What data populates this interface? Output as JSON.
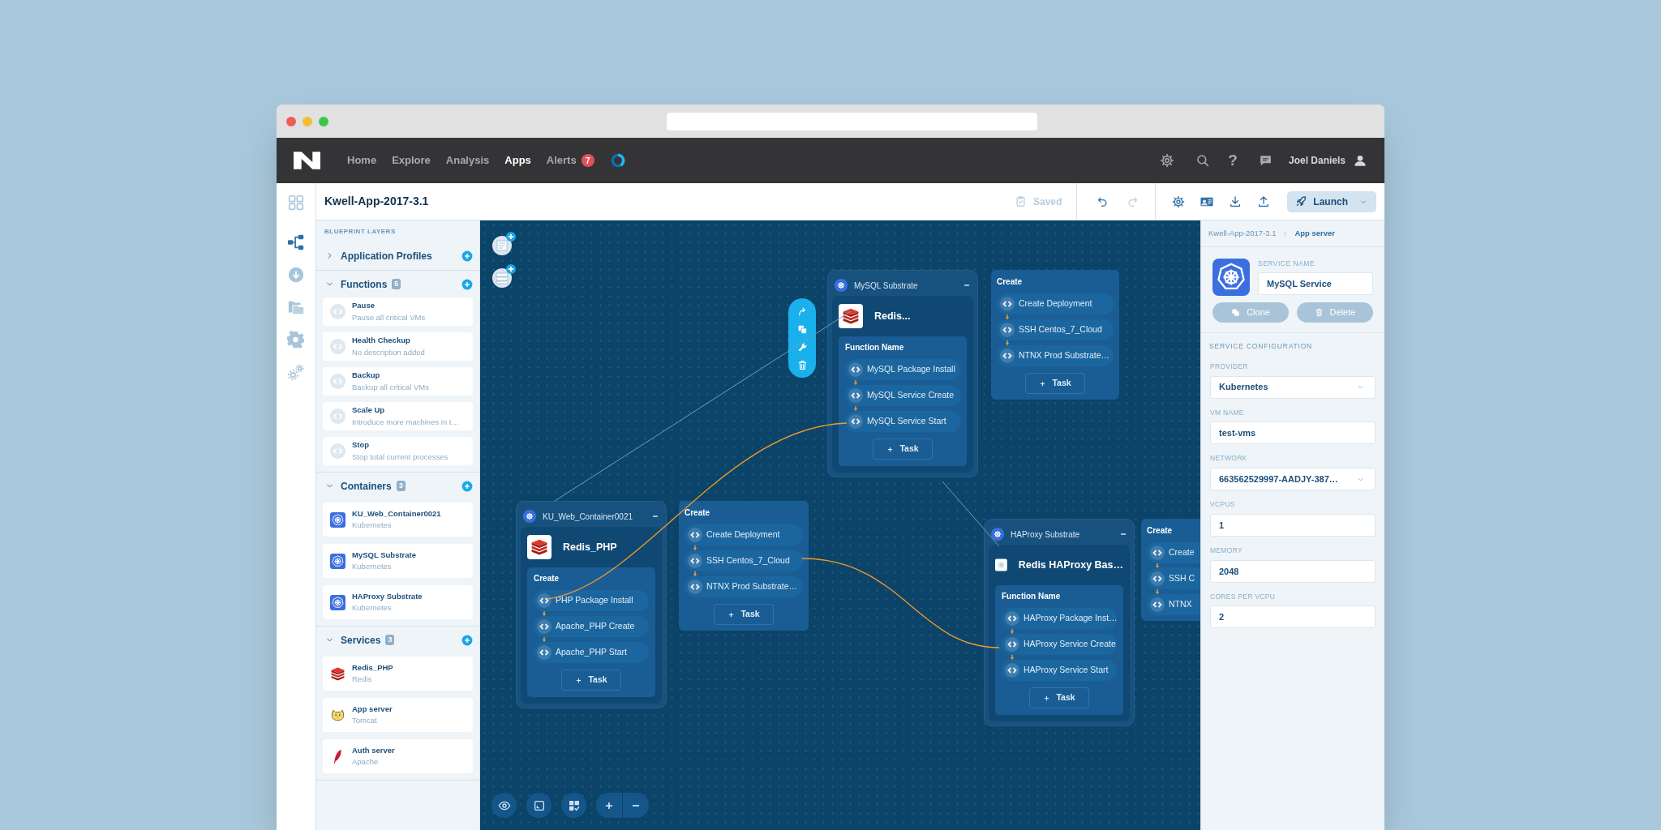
{
  "nav": {
    "links": [
      {
        "label": "Home",
        "selected": false
      },
      {
        "label": "Explore",
        "selected": false
      },
      {
        "label": "Analysis",
        "selected": false
      },
      {
        "label": "Apps",
        "selected": true
      },
      {
        "label": "Alerts",
        "selected": false,
        "badge": "7"
      }
    ],
    "help": "?",
    "user": "Joel Daniels"
  },
  "header": {
    "title": "Kwell-App-2017-3.1",
    "saved": "Saved",
    "launch": "Launch"
  },
  "rail": [
    {
      "kind": "grid",
      "selected": false
    },
    {
      "kind": "blueprint",
      "selected": true
    },
    {
      "kind": "download",
      "selected": false
    },
    {
      "kind": "folders",
      "selected": false
    },
    {
      "kind": "gear",
      "selected": false
    },
    {
      "kind": "gears",
      "selected": false
    }
  ],
  "sidebar": {
    "heading": "BLUEPRINT LAYERS",
    "sections": [
      {
        "title": "Application Profiles",
        "expanded": false
      },
      {
        "title": "Functions",
        "count": "5",
        "expanded": true,
        "items": [
          {
            "kind": "function",
            "title": "Pause",
            "subtitle": "Pause all critical VMs"
          },
          {
            "kind": "function",
            "title": "Health Checkup",
            "subtitle": "No description added"
          },
          {
            "kind": "function",
            "title": "Backup",
            "subtitle": "Backup all critical VMs"
          },
          {
            "kind": "function",
            "title": "Scale Up",
            "subtitle": "Introduce more machines in t…"
          },
          {
            "kind": "function",
            "title": "Stop",
            "subtitle": "Stop total current processes"
          }
        ]
      },
      {
        "title": "Containers",
        "count": "3",
        "expanded": true,
        "items": [
          {
            "kind": "kubernetes",
            "title": "KU_Web_Container0021",
            "subtitle": "Kubernetes"
          },
          {
            "kind": "kubernetes",
            "title": "MySQL Substrate",
            "subtitle": "Kubernetes"
          },
          {
            "kind": "kubernetes",
            "title": "HAProxy Substrate",
            "subtitle": "Kubernetes"
          }
        ]
      },
      {
        "title": "Services",
        "count": "3",
        "expanded": true,
        "items": [
          {
            "kind": "redis",
            "title": "Redis_PHP",
            "subtitle": "Redis"
          },
          {
            "kind": "tomcat",
            "title": "App server",
            "subtitle": "Tomcat"
          },
          {
            "kind": "apache",
            "title": "Auth server",
            "subtitle": "Apache"
          }
        ]
      }
    ]
  },
  "canvas": {
    "containers": [
      {
        "title": "MySQL Substrate",
        "service": {
          "kind": "redis",
          "name": "Redis..."
        },
        "card": {
          "title": "Function Name",
          "tasks": [
            "MySQL Package Install",
            "MySQL Service Create",
            "MySQL Service Start"
          ],
          "task_button": "Task"
        },
        "panel": {
          "title": "Create",
          "tasks": [
            "Create Deployment",
            "SSH Centos_7_Cloud",
            "NTNX Prod Substrate…"
          ],
          "task_button": "Task"
        }
      },
      {
        "title": "KU_Web_Container0021",
        "service": {
          "kind": "redis",
          "name": "Redis_PHP"
        },
        "card": {
          "title": "Create",
          "tasks": [
            "PHP Package Install",
            "Apache_PHP Create",
            "Apache_PHP Start"
          ],
          "task_button": "Task"
        },
        "panel": {
          "title": "Create",
          "tasks": [
            "Create Deployment",
            "SSH Centos_7_Cloud",
            "NTNX Prod Substrate…"
          ],
          "task_button": "Task"
        }
      },
      {
        "title": "HAProxy Substrate",
        "service": {
          "kind": "disc",
          "name": "Redis HAProxy Bas…"
        },
        "card": {
          "title": "Function Name",
          "tasks": [
            "HAProxy Package Inst…",
            "HAProxy Service Create",
            "HAProxy Service Start"
          ],
          "task_button": "Task"
        },
        "panel": {
          "title": "Create",
          "tasks": [
            "Create",
            "SSH C",
            "NTNX"
          ]
        }
      }
    ]
  },
  "inspector": {
    "breadcrumb": [
      "Kwell-App-2017-3.1",
      "App server"
    ],
    "service_name_label": "SERVICE NAME",
    "service_name": "MySQL Service",
    "buttons": [
      {
        "kind": "clone",
        "label": "Clone",
        "disabled": true
      },
      {
        "kind": "delete",
        "label": "Delete",
        "disabled": true
      }
    ],
    "section": "SERVICE CONFIGURATION",
    "fields": [
      {
        "kind": "select",
        "label": "PROVIDER",
        "value": "Kubernetes"
      },
      {
        "kind": "text",
        "label": "VM NAME",
        "value": "test-vms"
      },
      {
        "kind": "select",
        "label": "NETWORK",
        "value": "663562529997-AADJY-387…"
      },
      {
        "kind": "text",
        "label": "VCPUS",
        "value": "1"
      },
      {
        "kind": "text",
        "label": "MEMORY",
        "value": "2048"
      },
      {
        "kind": "text",
        "label": "CORES PER VCPU",
        "value": "2"
      }
    ]
  }
}
